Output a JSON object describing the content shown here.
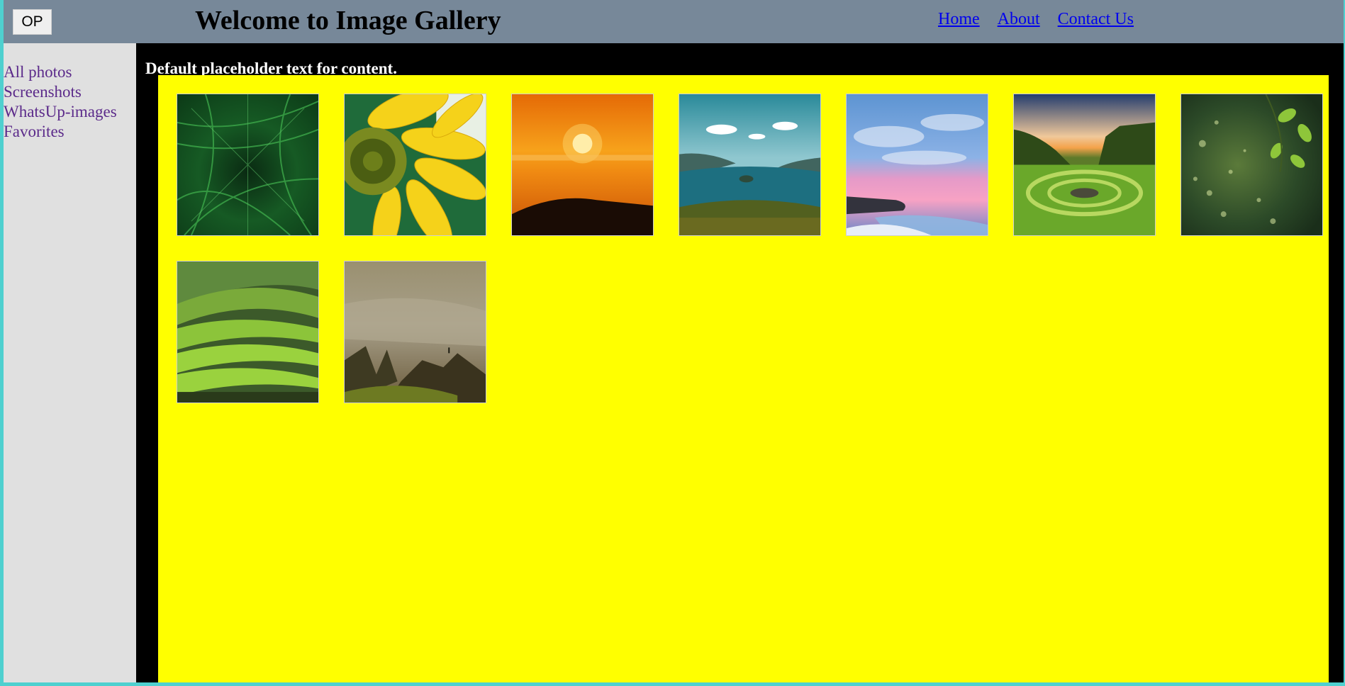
{
  "header": {
    "menu_button_label": "OP",
    "title": "Welcome to Image Gallery",
    "nav": [
      {
        "label": "Home"
      },
      {
        "label": "About"
      },
      {
        "label": "Contact Us"
      }
    ]
  },
  "sidebar": {
    "items": [
      {
        "label": "All photos"
      },
      {
        "label": "Screenshots"
      },
      {
        "label": "WhatsUp-images"
      },
      {
        "label": "Favorites"
      }
    ]
  },
  "main": {
    "intro_text": "Default placeholder text for content."
  },
  "gallery": {
    "photos": [
      {
        "subject": "fern-leaves"
      },
      {
        "subject": "sunflower"
      },
      {
        "subject": "orange-sunset-over-sea"
      },
      {
        "subject": "lake-with-islands"
      },
      {
        "subject": "pink-sunset-beach"
      },
      {
        "subject": "green-valley-stone-circle"
      },
      {
        "subject": "green-leaves-bokeh"
      },
      {
        "subject": "green-rolling-hills"
      },
      {
        "subject": "misty-mountain-peaks"
      }
    ]
  },
  "colors": {
    "header_bg": "#778899",
    "sidebar_bg": "#e0e0e0",
    "content_bg": "#000000",
    "gallery_bg": "#ffff00",
    "link_color": "#0000ee",
    "sidebar_link_color": "#5b2a8a",
    "outer_frame": "#4fd0cf"
  }
}
